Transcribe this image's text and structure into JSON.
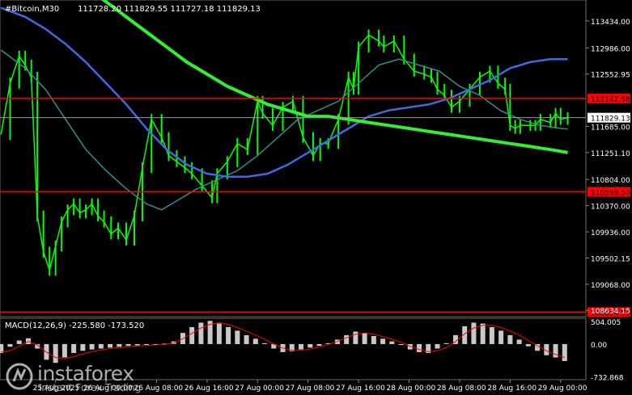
{
  "header": {
    "symbol_tf": "#Bitcoin,M30",
    "ohlc": "111728.20 111829.55 111727.18 111829.13"
  },
  "macd": {
    "label": "MACD(12,26,9) -225.580 -173.520"
  },
  "branding": {
    "name": "instaforex",
    "tagline": "Instant Forex Trading"
  },
  "colors": {
    "background": "#000000",
    "candles": "#00ff00",
    "ma_fast": "#2f8f8f",
    "ma_mid": "#4169e1",
    "ma_slow": "#33ee33",
    "levels": "#ff0000",
    "price_line": "#9a9a9a",
    "macd_hist": "#c8c8c8",
    "macd_signal": "#ff0000",
    "axis_text": "#ffffff"
  },
  "chart_data": [
    {
      "type": "line",
      "title": "#Bitcoin,M30",
      "y_ticks": [
        {
          "value": 113434.0,
          "label": "113434.00"
        },
        {
          "value": 112986.0,
          "label": "112986.00"
        },
        {
          "value": 112552.95,
          "label": "112552.95"
        },
        {
          "value": 111685.0,
          "label": "111685.00"
        },
        {
          "value": 111251.1,
          "label": "111251.10"
        },
        {
          "value": 110804.0,
          "label": "110804.00"
        },
        {
          "value": 110370.0,
          "label": "110370.00"
        },
        {
          "value": 109936.0,
          "label": "109936.00"
        },
        {
          "value": 109502.15,
          "label": "109502.15"
        },
        {
          "value": 109068.0,
          "label": "109068.00"
        },
        {
          "value": 108634.15,
          "label": "108634.15"
        }
      ],
      "ylim": [
        108530,
        113780
      ],
      "x_ticks": [
        "25 Aug 2025",
        "26 Aug 00:00",
        "26 Aug 08:00",
        "26 Aug 16:00",
        "27 Aug 00:00",
        "27 Aug 08:00",
        "27 Aug 16:00",
        "28 Aug 00:00",
        "28 Aug 08:00",
        "28 Aug 16:00",
        "29 Aug 00:00"
      ],
      "x_tick_positions": [
        0,
        0.5,
        1,
        1.5,
        2,
        2.5,
        3,
        3.5,
        4,
        4.5,
        5
      ],
      "xlim": [
        -0.55,
        5.25
      ],
      "horizontal_levels": [
        {
          "value": 112147.58,
          "label": "112147.58",
          "color": "#ff0000"
        },
        {
          "value": 110598.5,
          "label": "110598.50",
          "color": "#ff0000"
        },
        {
          "value": 108604.53,
          "label": "108604.53",
          "color": "#ff0000"
        }
      ],
      "current_price": {
        "value": 111829.13,
        "label": "111829.13"
      },
      "price_series": {
        "name": "Close",
        "x": [
          -0.54,
          -0.45,
          -0.36,
          -0.3,
          -0.24,
          -0.18,
          -0.12,
          -0.06,
          0.0,
          0.06,
          0.12,
          0.18,
          0.24,
          0.3,
          0.36,
          0.42,
          0.48,
          0.55,
          0.62,
          0.7,
          0.78,
          0.86,
          0.95,
          1.05,
          1.12,
          1.2,
          1.28,
          1.35,
          1.45,
          1.55,
          1.6,
          1.7,
          1.8,
          1.9,
          2.0,
          2.05,
          2.15,
          2.25,
          2.35,
          2.45,
          2.55,
          2.62,
          2.7,
          2.8,
          2.9,
          2.95,
          3.0,
          3.1,
          3.2,
          3.25,
          3.35,
          3.45,
          3.55,
          3.65,
          3.72,
          3.78,
          3.85,
          3.92,
          4.0,
          4.1,
          4.2,
          4.3,
          4.38,
          4.45,
          4.5,
          4.55,
          4.6,
          4.7,
          4.75,
          4.8,
          4.9,
          4.95,
          5.0,
          5.07
        ],
        "y": [
          111550,
          112400,
          112850,
          112700,
          112500,
          110200,
          109600,
          109300,
          109700,
          110100,
          110300,
          110400,
          110250,
          110300,
          110400,
          110200,
          110100,
          109900,
          110000,
          109800,
          110200,
          111000,
          111800,
          111500,
          111200,
          111100,
          111000,
          110900,
          110700,
          110500,
          110900,
          111100,
          111400,
          111300,
          112100,
          111900,
          111700,
          112000,
          112100,
          111500,
          111200,
          111400,
          111400,
          111800,
          112500,
          112300,
          113000,
          113200,
          113100,
          113000,
          113100,
          112800,
          112600,
          112550,
          112500,
          112300,
          112200,
          112000,
          112100,
          112300,
          112500,
          112600,
          112400,
          112300,
          111700,
          111650,
          111700,
          111700,
          111700,
          111800,
          111750,
          111900,
          111800,
          111829
        ],
        "ylim": [
          108530,
          113780
        ]
      },
      "moving_averages": [
        {
          "name": "MA fast",
          "x": [
            -0.54,
            -0.3,
            -0.1,
            0.1,
            0.3,
            0.5,
            0.7,
            0.9,
            1.05,
            1.2,
            1.4,
            1.6,
            1.8,
            2.0,
            2.2,
            2.4,
            2.6,
            2.8,
            3.0,
            3.2,
            3.4,
            3.6,
            3.8,
            4.0,
            4.2,
            4.4,
            4.6,
            4.8,
            5.0,
            5.07
          ],
          "y": [
            112950,
            112650,
            112300,
            111800,
            111300,
            110950,
            110650,
            110400,
            110300,
            110450,
            110650,
            110800,
            110950,
            111200,
            111500,
            111800,
            111950,
            112100,
            112400,
            112700,
            112800,
            112700,
            112600,
            112350,
            112200,
            111950,
            111800,
            111700,
            111650,
            111640
          ]
        },
        {
          "name": "MA mid",
          "x": [
            -0.54,
            -0.3,
            -0.1,
            0.1,
            0.3,
            0.5,
            0.7,
            0.9,
            1.1,
            1.3,
            1.5,
            1.7,
            1.9,
            2.1,
            2.3,
            2.5,
            2.7,
            2.9,
            3.1,
            3.3,
            3.5,
            3.7,
            3.9,
            4.1,
            4.3,
            4.5,
            4.7,
            4.9,
            5.07
          ],
          "y": [
            113650,
            113500,
            113300,
            113050,
            112750,
            112400,
            112050,
            111650,
            111300,
            111050,
            110900,
            110850,
            110850,
            110900,
            111050,
            111250,
            111450,
            111650,
            111850,
            111950,
            112000,
            112050,
            112150,
            112300,
            112450,
            112650,
            112750,
            112800,
            112800
          ]
        },
        {
          "name": "MA slow",
          "x": [
            -0.54,
            -0.3,
            -0.1,
            0.1,
            0.3,
            0.5,
            0.7,
            0.9,
            1.1,
            1.3,
            1.5,
            1.7,
            1.9,
            2.1,
            2.3,
            2.5,
            2.7,
            2.9,
            3.1,
            3.3,
            3.5,
            3.7,
            3.9,
            4.1,
            4.3,
            4.5,
            4.7,
            4.9,
            5.07
          ],
          "y": [
            114600,
            114500,
            114350,
            114200,
            114000,
            113750,
            113500,
            113250,
            113000,
            112750,
            112550,
            112350,
            112200,
            112050,
            111950,
            111850,
            111850,
            111800,
            111750,
            111700,
            111650,
            111600,
            111550,
            111500,
            111450,
            111400,
            111350,
            111300,
            111250
          ]
        }
      ]
    },
    {
      "type": "bar",
      "title": "MACD(12,26,9)",
      "y_ticks": [
        {
          "value": 504.005,
          "label": "504.005"
        },
        {
          "value": 0.0,
          "label": "0.00"
        },
        {
          "value": -732.868,
          "label": "-732.868"
        }
      ],
      "ylim": [
        -760,
        560
      ],
      "x": [
        -0.54,
        -0.45,
        -0.36,
        -0.27,
        -0.18,
        -0.09,
        0.0,
        0.09,
        0.18,
        0.27,
        0.36,
        0.45,
        0.54,
        0.63,
        0.72,
        0.81,
        0.9,
        0.99,
        1.08,
        1.17,
        1.26,
        1.35,
        1.44,
        1.53,
        1.62,
        1.71,
        1.8,
        1.89,
        1.98,
        2.07,
        2.16,
        2.25,
        2.34,
        2.43,
        2.52,
        2.61,
        2.7,
        2.79,
        2.88,
        2.97,
        3.06,
        3.15,
        3.24,
        3.33,
        3.42,
        3.51,
        3.6,
        3.69,
        3.78,
        3.87,
        3.96,
        4.05,
        4.14,
        4.23,
        4.32,
        4.41,
        4.5,
        4.59,
        4.68,
        4.77,
        4.86,
        4.95,
        5.04
      ],
      "histogram": [
        -200,
        -60,
        80,
        130,
        -100,
        -350,
        -420,
        -300,
        -200,
        -150,
        -120,
        -100,
        -80,
        -60,
        -40,
        -30,
        -20,
        -10,
        10,
        60,
        250,
        380,
        480,
        520,
        460,
        380,
        300,
        200,
        120,
        20,
        -100,
        -180,
        -160,
        -120,
        -80,
        -40,
        20,
        100,
        200,
        280,
        250,
        180,
        120,
        60,
        -20,
        -120,
        -180,
        -200,
        -100,
        20,
        200,
        400,
        480,
        460,
        380,
        300,
        200,
        100,
        -50,
        -150,
        -250,
        -300,
        -380
      ],
      "signal": [
        -180,
        -150,
        -50,
        60,
        -20,
        -180,
        -300,
        -330,
        -280,
        -220,
        -170,
        -130,
        -100,
        -80,
        -60,
        -40,
        -30,
        -20,
        -10,
        20,
        120,
        240,
        360,
        440,
        480,
        440,
        370,
        290,
        200,
        110,
        0,
        -90,
        -140,
        -140,
        -110,
        -70,
        -10,
        60,
        140,
        220,
        250,
        220,
        170,
        110,
        40,
        -50,
        -120,
        -170,
        -150,
        -80,
        60,
        230,
        360,
        420,
        420,
        370,
        290,
        200,
        80,
        -40,
        -150,
        -230,
        -300
      ]
    }
  ]
}
